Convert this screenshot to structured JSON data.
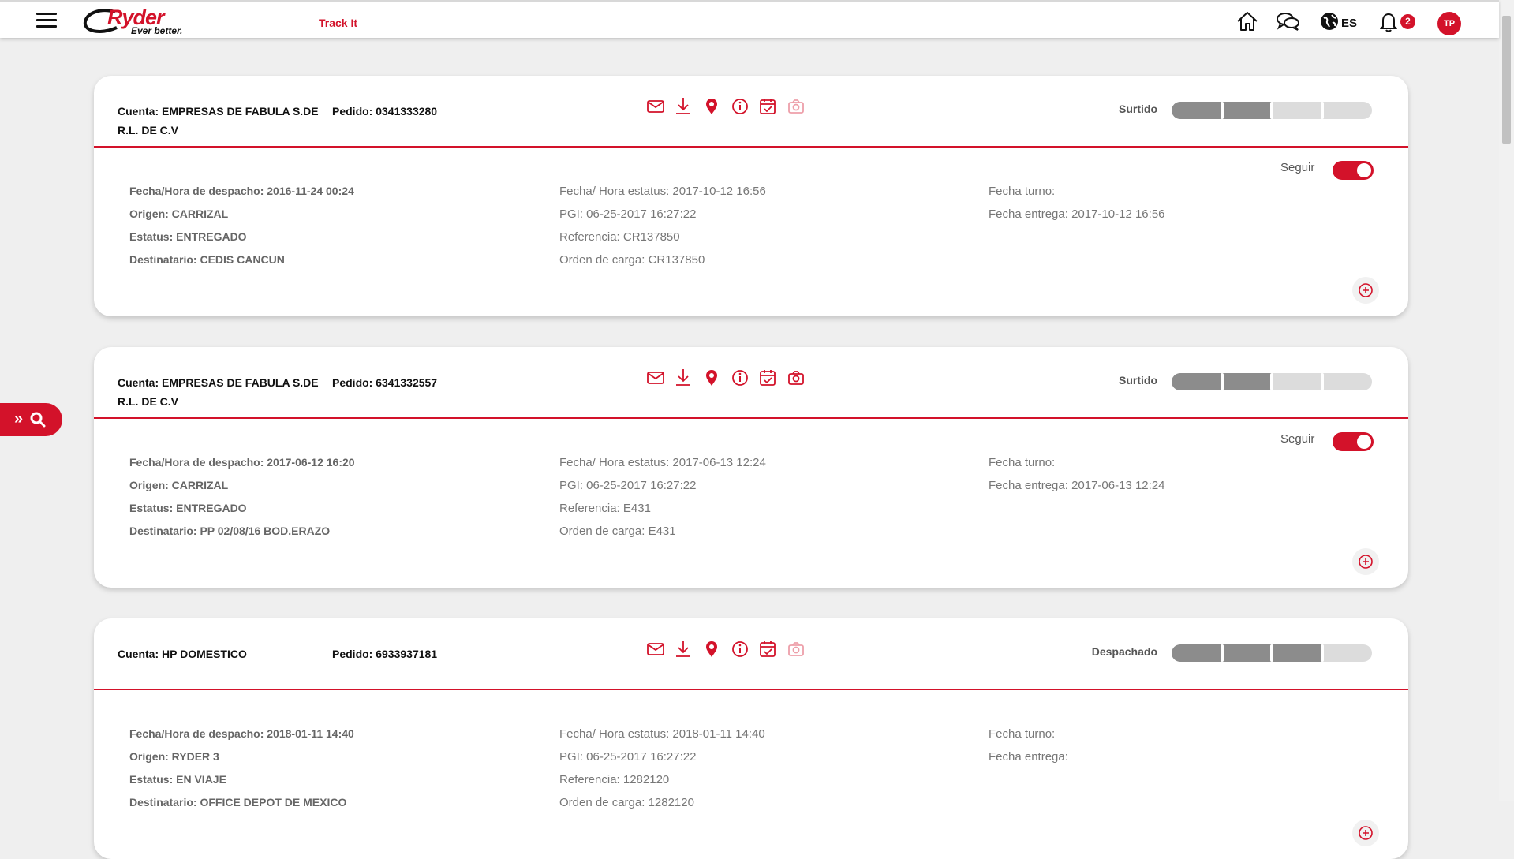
{
  "app": {
    "brand": "Ryder",
    "tagline": "Ever better.",
    "nav_link": "Track It"
  },
  "header": {
    "language": "ES",
    "notifications": "2",
    "user_initials": "TP"
  },
  "labels": {
    "cuenta": "Cuenta:",
    "pedido": "Pedido:",
    "despacho": "Fecha/Hora de despacho:",
    "origen": "Origen:",
    "estatus": "Estatus:",
    "destinatario": "Destinatario:",
    "fecha_estatus": "Fecha/ Hora estatus:",
    "pgi": "PGI:",
    "referencia": "Referencia:",
    "orden": "Orden de carga:",
    "turno": "Fecha turno:",
    "entrega": "Fecha entrega:",
    "seguir": "Seguir"
  },
  "orders": [
    {
      "cuenta_line1": "Cuenta: EMPRESAS DE FABULA S.DE",
      "cuenta_line2": "R.L. DE C.V",
      "pedido": "Pedido: 0341333280",
      "status": "Surtido",
      "progress_steps_done": 2,
      "progress_steps_total": 4,
      "photo_enabled": false,
      "following": true,
      "despacho": "Fecha/Hora de despacho: 2016-11-24 00:24",
      "origen": "Origen: CARRIZAL",
      "estatus": "Estatus: ENTREGADO",
      "destinatario": "Destinatario: CEDIS CANCUN",
      "fecha_estatus": "Fecha/ Hora estatus: 2017-10-12 16:56",
      "pgi": "PGI: 06-25-2017 16:27:22",
      "referencia": "Referencia: CR137850",
      "orden": "Orden de carga: CR137850",
      "turno": "Fecha turno:",
      "entrega": "Fecha entrega: 2017-10-12 16:56"
    },
    {
      "cuenta_line1": "Cuenta: EMPRESAS DE FABULA S.DE",
      "cuenta_line2": "R.L. DE C.V",
      "pedido": "Pedido: 6341332557",
      "status": "Surtido",
      "progress_steps_done": 2,
      "progress_steps_total": 4,
      "photo_enabled": true,
      "following": true,
      "despacho": "Fecha/Hora de despacho: 2017-06-12 16:20",
      "origen": "Origen: CARRIZAL",
      "estatus": "Estatus: ENTREGADO",
      "destinatario": "Destinatario: PP 02/08/16 BOD.ERAZO",
      "fecha_estatus": "Fecha/ Hora estatus: 2017-06-13 12:24",
      "pgi": "PGI: 06-25-2017 16:27:22",
      "referencia": "Referencia: E431",
      "orden": "Orden de carga: E431",
      "turno": "Fecha turno:",
      "entrega": "Fecha entrega: 2017-06-13 12:24"
    },
    {
      "cuenta_line1": "Cuenta: HP DOMESTICO",
      "cuenta_line2": "",
      "pedido": "Pedido: 6933937181",
      "status": "Despachado",
      "progress_steps_done": 3,
      "progress_steps_total": 4,
      "photo_enabled": false,
      "following": false,
      "despacho": "Fecha/Hora de despacho: 2018-01-11 14:40",
      "origen": "Origen: RYDER 3",
      "estatus": "Estatus: EN VIAJE",
      "destinatario": "Destinatario: OFFICE DEPOT DE MEXICO",
      "fecha_estatus": "Fecha/ Hora estatus: 2018-01-11 14:40",
      "pgi": "PGI: 06-25-2017 16:27:22",
      "referencia": "Referencia: 1282120",
      "orden": "Orden de carga: 1282120",
      "turno": "Fecha turno:",
      "entrega": "Fecha entrega:"
    }
  ],
  "icons": {
    "menu": "hamburger-menu-icon",
    "home": "home-icon",
    "chat": "chat-bubbles-icon",
    "globe": "globe-icon",
    "bell": "bell-icon",
    "mail": "envelope-icon",
    "download": "download-icon",
    "location": "map-pin-icon",
    "info": "info-circle-icon",
    "calendar": "calendar-check-icon",
    "camera": "camera-icon",
    "expand": "plus-circle-icon",
    "search": "search-icon"
  },
  "colors": {
    "brand_red": "#d3122a",
    "progress_done": "#8c8c8c",
    "progress_todo": "#dcdcdc",
    "photo_disabled": "#e8a4ad"
  }
}
